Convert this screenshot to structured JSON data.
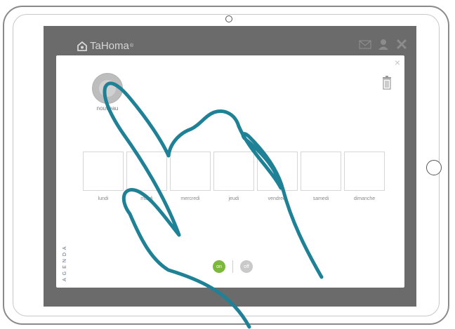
{
  "app": {
    "logo_text": "TaHoma",
    "logo_mark": "®"
  },
  "toolbar": {
    "icons": [
      "mail-icon",
      "user-icon",
      "close-icon"
    ]
  },
  "modal": {
    "close_glyph": "×",
    "new_label": "nouveau",
    "days": [
      "lundi",
      "mardi",
      "mercredi",
      "jeudi",
      "vendredi",
      "samedi",
      "dimanche"
    ],
    "side_label": "AGENDA",
    "toggle": {
      "on_label": "on",
      "off_label": "off"
    }
  },
  "colors": {
    "hand_stroke": "#1f8196",
    "toggle_on": "#7cb83c",
    "screen_bg": "#6b6b6b"
  }
}
